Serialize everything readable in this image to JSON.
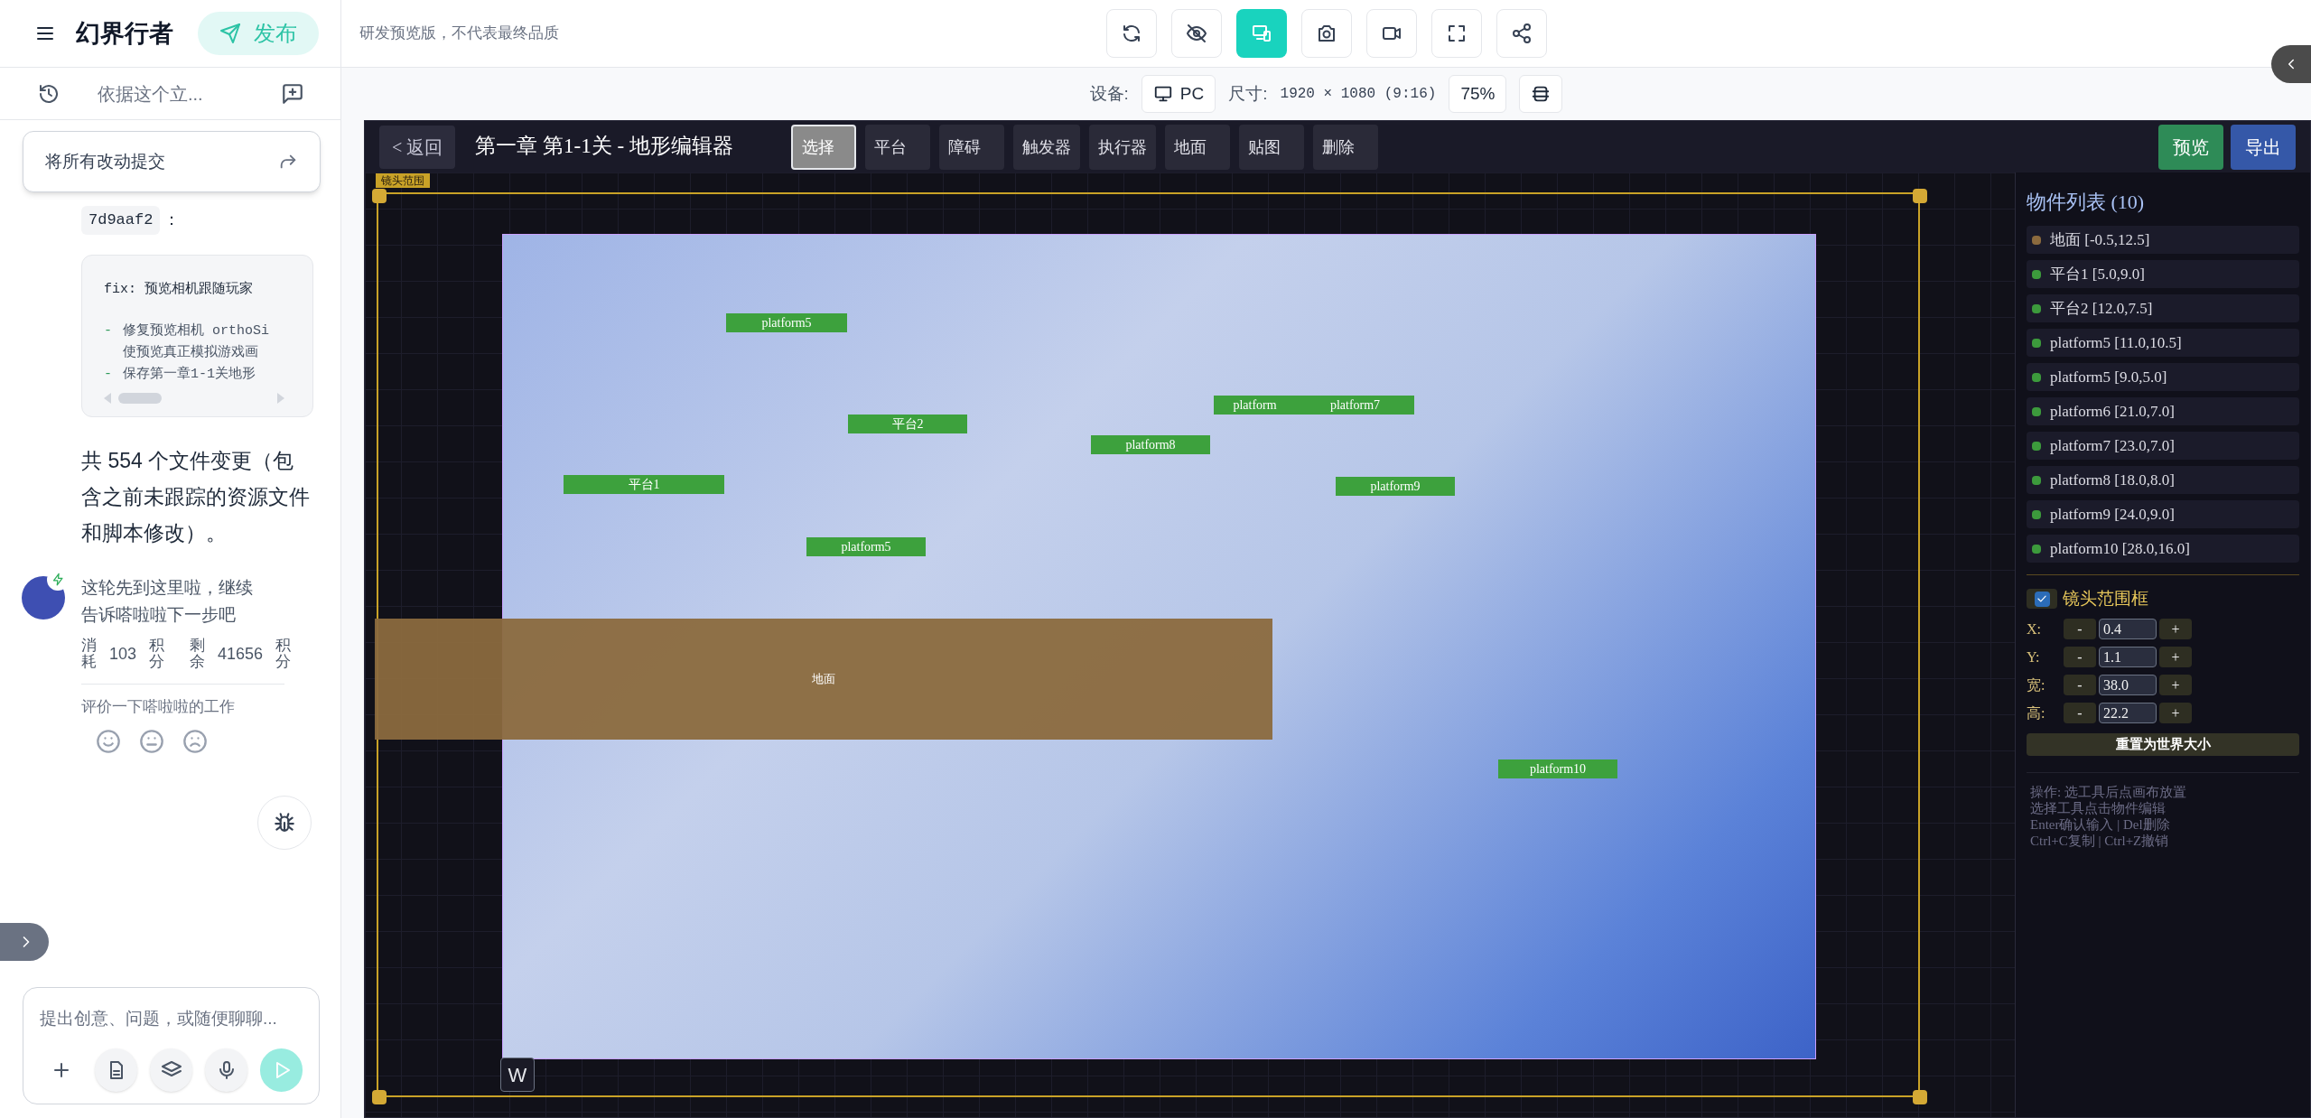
{
  "app": {
    "title": "幻界行者",
    "publish": "发布"
  },
  "chat_tab": {
    "title": "依据这个立..."
  },
  "commit_popup": {
    "label": "将所有改动提交"
  },
  "chat": {
    "commit_hash": "7d9aaf2",
    "hash_suffix": "：",
    "code_lines": [
      {
        "kind": "title",
        "text": "fix: 预览相机跟随玩家"
      },
      {
        "kind": "bullet",
        "marker": "-",
        "text": "修复预览相机 orthoSi"
      },
      {
        "kind": "continuation",
        "text": "使预览真正模拟游戏画"
      },
      {
        "kind": "bullet",
        "marker": "-",
        "text": "保存第一章1-1关地形"
      }
    ],
    "summary": "共 554 个文件变更（包含之前未跟踪的资源文件和脚本修改）。",
    "reply": "这轮先到这里啦，继续告诉嗒啦啦下一步吧",
    "stats": [
      {
        "label": "消耗",
        "value": "103",
        "unit": "积分"
      },
      {
        "label": "剩余",
        "value": "41656",
        "unit": "积分"
      }
    ],
    "rating_prompt": "评价一下嗒啦啦的工作"
  },
  "composer": {
    "placeholder": "提出创意、问题，或随便聊聊..."
  },
  "top_bar": {
    "notice": "研发预览版，不代表最终品质",
    "tools": [
      {
        "kind": "refresh",
        "selected": false
      },
      {
        "kind": "hide",
        "selected": false
      },
      {
        "kind": "device",
        "selected": true
      },
      {
        "kind": "camera",
        "selected": false
      },
      {
        "kind": "video",
        "selected": false
      },
      {
        "kind": "fullscreen",
        "selected": false
      },
      {
        "kind": "share",
        "selected": false
      }
    ]
  },
  "device_bar": {
    "device_label": "设备:",
    "device": "PC",
    "size_label": "尺寸:",
    "size": "1920 × 1080 (9:16)",
    "zoom": "75%"
  },
  "editor": {
    "back": "< 返回",
    "title": "第一章 第1-1关 - 地形编辑器",
    "tools": [
      {
        "label": "选择",
        "selected": true
      },
      {
        "label": "平台",
        "selected": false
      },
      {
        "label": "障碍",
        "selected": false
      },
      {
        "label": "触发器",
        "selected": false
      },
      {
        "label": "执行器",
        "selected": false
      },
      {
        "label": "地面",
        "selected": false
      },
      {
        "label": "贴图",
        "selected": false
      },
      {
        "label": "删除",
        "selected": false
      }
    ],
    "actions": [
      {
        "label": "预览",
        "kind": "preview"
      },
      {
        "label": "导出",
        "kind": "export"
      }
    ],
    "canvas": {
      "camera_label": "镜头范围",
      "key_hint": "W",
      "objects": [
        {
          "label": "platform5",
          "kind": "platform"
        },
        {
          "label": "平台2",
          "kind": "platform"
        },
        {
          "label": "platform",
          "kind": "platform"
        },
        {
          "label": "platform7",
          "kind": "platform"
        },
        {
          "label": "platform8",
          "kind": "platform"
        },
        {
          "label": "平台1",
          "kind": "platform"
        },
        {
          "label": "platform9",
          "kind": "platform"
        },
        {
          "label": "platform5",
          "kind": "platform"
        },
        {
          "label": "地面",
          "kind": "ground"
        },
        {
          "label": "platform10",
          "kind": "platform"
        }
      ]
    },
    "object_list": {
      "title": "物件列表 (10)",
      "items": [
        {
          "label": "地面 [-0.5,12.5]",
          "color": "#8b6a3e"
        },
        {
          "label": "平台1 [5.0,9.0]",
          "color": "#3c9a3c"
        },
        {
          "label": "平台2 [12.0,7.5]",
          "color": "#3c9a3c"
        },
        {
          "label": "platform5 [11.0,10.5]",
          "color": "#3c9a3c"
        },
        {
          "label": "platform5 [9.0,5.0]",
          "color": "#3c9a3c"
        },
        {
          "label": "platform6 [21.0,7.0]",
          "color": "#3c9a3c"
        },
        {
          "label": "platform7 [23.0,7.0]",
          "color": "#3c9a3c"
        },
        {
          "label": "platform8 [18.0,8.0]",
          "color": "#3c9a3c"
        },
        {
          "label": "platform9 [24.0,9.0]",
          "color": "#3c9a3c"
        },
        {
          "label": "platform10 [28.0,16.0]",
          "color": "#3c9a3c"
        }
      ]
    },
    "camera_box": {
      "label": "镜头范围框",
      "checked": true,
      "fields": [
        {
          "label": "X:",
          "decrement": "-",
          "value": "0.4",
          "increment": "+"
        },
        {
          "label": "Y:",
          "decrement": "-",
          "value": "1.1",
          "increment": "+"
        },
        {
          "label": "宽:",
          "decrement": "-",
          "value": "38.0",
          "increment": "+"
        },
        {
          "label": "高:",
          "decrement": "-",
          "value": "22.2",
          "increment": "+"
        }
      ],
      "reset": "重置为世界大小"
    },
    "help": [
      "操作: 选工具后点画布放置",
      "选择工具点击物件编辑",
      "Enter确认输入 | Del删除",
      "Ctrl+C复制 | Ctrl+Z撤销"
    ]
  }
}
